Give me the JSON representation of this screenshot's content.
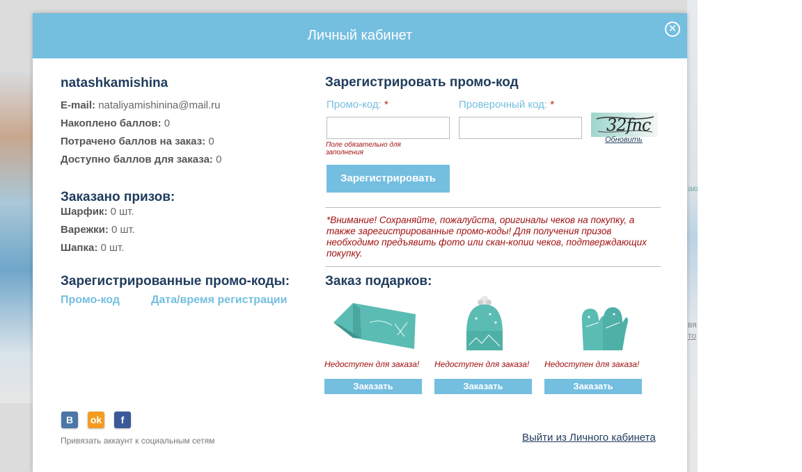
{
  "background": {
    "right_text_1": "аки",
    "right_text_2": "вя",
    "right_text_3": "то"
  },
  "modal": {
    "title": "Личный кабинет",
    "close_icon": "close-icon"
  },
  "profile": {
    "username": "natashkamishina",
    "email_label": "E-mail:",
    "email_value": "nataliyamishinina@mail.ru",
    "points_earned_label": "Накоплено баллов:",
    "points_earned_value": "0",
    "points_spent_label": "Потрачено баллов на заказ:",
    "points_spent_value": "0",
    "points_available_label": "Доступно баллов для заказа:",
    "points_available_value": "0"
  },
  "prizes": {
    "title": "Заказано призов:",
    "items": [
      {
        "label": "Шарфик:",
        "value": "0 шт."
      },
      {
        "label": "Варежки:",
        "value": "0 шт."
      },
      {
        "label": "Шапка:",
        "value": "0 шт."
      }
    ]
  },
  "codes": {
    "title": "Зарегистрированные промо-коды:",
    "columns": [
      "Промо-код",
      "Дата/время регистрации"
    ]
  },
  "register": {
    "title": "Зарегистрировать промо-код",
    "promo_label": "Промо-код:",
    "captcha_label": "Проверочный код:",
    "required_mark": "*",
    "promo_value": "",
    "captcha_value": "",
    "required_hint": "Поле обязательно для заполнения",
    "captcha_text": "32fnc",
    "refresh_label": "Обновить",
    "submit_label": "Зарегистрировать"
  },
  "notice": "*Внимание! Сохраняйте, пожалуйста, оригиналы чеков на покупку, а также зарегистрированные промо-коды! Для получения призов необходимо предъявить фото или скан-копии чеков, подтверждающих покупку.",
  "gifts": {
    "title": "Заказ подарков:",
    "items": [
      {
        "name": "scarf",
        "icon": "scarf-icon",
        "status": "Недоступен для заказа!",
        "button": "Заказать"
      },
      {
        "name": "hat",
        "icon": "hat-icon",
        "status": "Недоступен для заказа!",
        "button": "Заказать"
      },
      {
        "name": "mittens",
        "icon": "mittens-icon",
        "status": "Недоступен для заказа!",
        "button": "Заказать"
      }
    ],
    "color": "#5bbcb4"
  },
  "social": {
    "icons": [
      {
        "name": "vk-icon",
        "glyph": "В",
        "color": "#4a76a8"
      },
      {
        "name": "odnoklassniki-icon",
        "glyph": "ok",
        "color": "#f39c21"
      },
      {
        "name": "facebook-icon",
        "glyph": "f",
        "color": "#3b5998"
      }
    ],
    "caption": "Привязать аккаунт к социальным сетям"
  },
  "logout_label": "Выйти из Личного кабинета",
  "colors": {
    "accent": "#74bee0",
    "title": "#1f3b5c",
    "error": "#a01010"
  }
}
